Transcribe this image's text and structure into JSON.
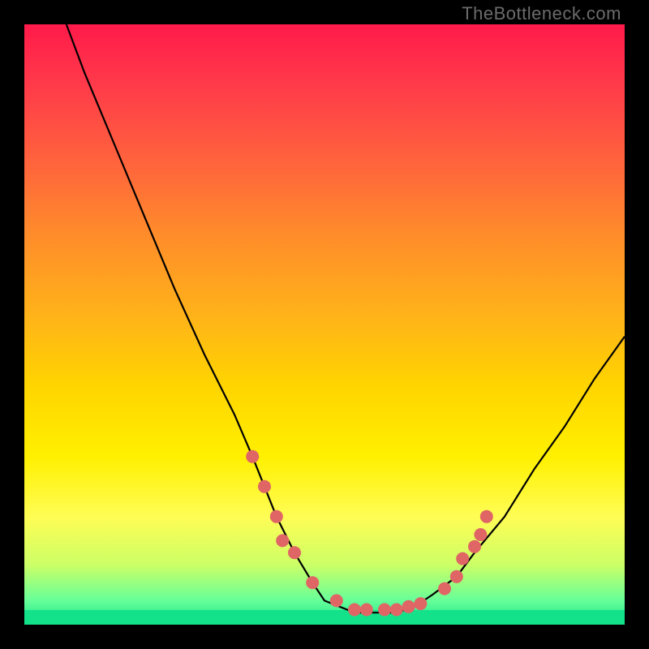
{
  "watermark": "TheBottleneck.com",
  "chart_data": {
    "type": "line",
    "title": "",
    "xlabel": "",
    "ylabel": "",
    "xlim": [
      0,
      100
    ],
    "ylim": [
      0,
      100
    ],
    "curve": {
      "name": "bottleneck-curve",
      "x": [
        7,
        10,
        15,
        20,
        25,
        30,
        35,
        38,
        40,
        42,
        45,
        48,
        50,
        55,
        58,
        60,
        62,
        65,
        68,
        72,
        75,
        80,
        85,
        90,
        95,
        100
      ],
      "y": [
        100,
        92,
        80,
        68,
        56,
        45,
        35,
        28,
        23,
        18,
        12,
        7,
        4,
        2,
        2,
        2,
        2,
        3,
        5,
        8,
        12,
        18,
        26,
        33,
        41,
        48
      ]
    },
    "dots": {
      "name": "data-markers",
      "color": "#e06666",
      "radius_px": 8,
      "points": [
        {
          "x": 38,
          "y": 28
        },
        {
          "x": 40,
          "y": 23
        },
        {
          "x": 42,
          "y": 18
        },
        {
          "x": 43,
          "y": 14
        },
        {
          "x": 45,
          "y": 12
        },
        {
          "x": 48,
          "y": 7
        },
        {
          "x": 52,
          "y": 4
        },
        {
          "x": 55,
          "y": 2.5
        },
        {
          "x": 57,
          "y": 2.5
        },
        {
          "x": 60,
          "y": 2.5
        },
        {
          "x": 62,
          "y": 2.5
        },
        {
          "x": 64,
          "y": 3
        },
        {
          "x": 66,
          "y": 3.5
        },
        {
          "x": 70,
          "y": 6
        },
        {
          "x": 72,
          "y": 8
        },
        {
          "x": 73,
          "y": 11
        },
        {
          "x": 75,
          "y": 13
        },
        {
          "x": 76,
          "y": 15
        },
        {
          "x": 77,
          "y": 18
        }
      ]
    }
  }
}
